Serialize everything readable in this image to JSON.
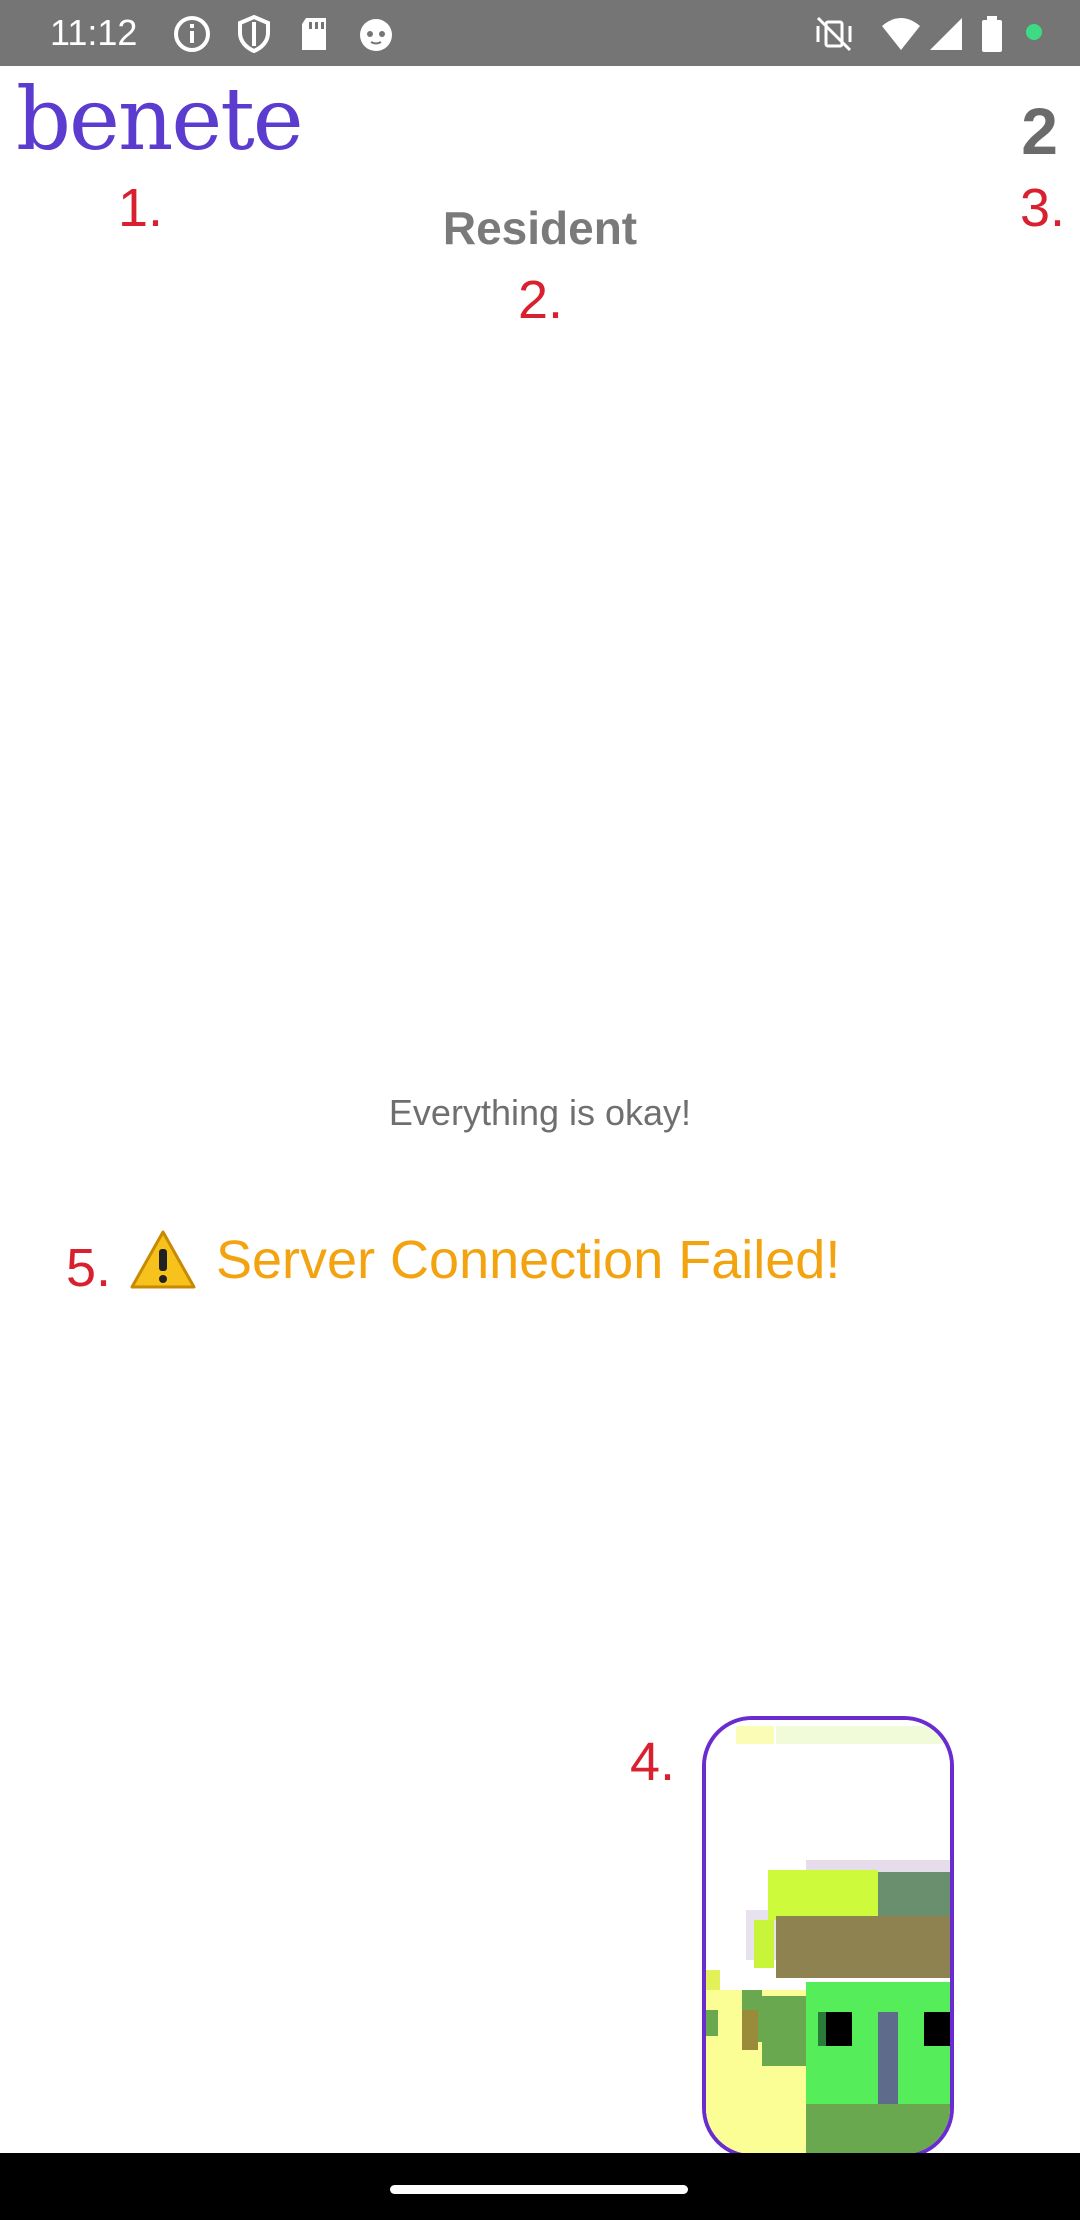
{
  "status_bar": {
    "time": "11:12",
    "left_icons": [
      "info-icon",
      "shield-icon",
      "sd-card-icon",
      "cat-face-icon"
    ],
    "right_icons": [
      "vibrate-off-icon",
      "wifi-icon",
      "signal-icon",
      "battery-icon",
      "notification-dot-icon"
    ]
  },
  "header": {
    "logo_text": "benete",
    "title": "Resident",
    "counter": "2"
  },
  "annotations": {
    "a1": "1.",
    "a2": "2.",
    "a3": "3.",
    "a4": "4.",
    "a5": "5."
  },
  "main": {
    "status_message": "Everything is okay!",
    "warning_text": "Server Connection Failed!",
    "warning_icon": "warning-triangle-icon"
  },
  "colors": {
    "status_bar": "#757575",
    "logo": "#5b3ccf",
    "annotation": "#d8202f",
    "warning": "#f2a30f",
    "avatar_border": "#6a2bd0"
  }
}
